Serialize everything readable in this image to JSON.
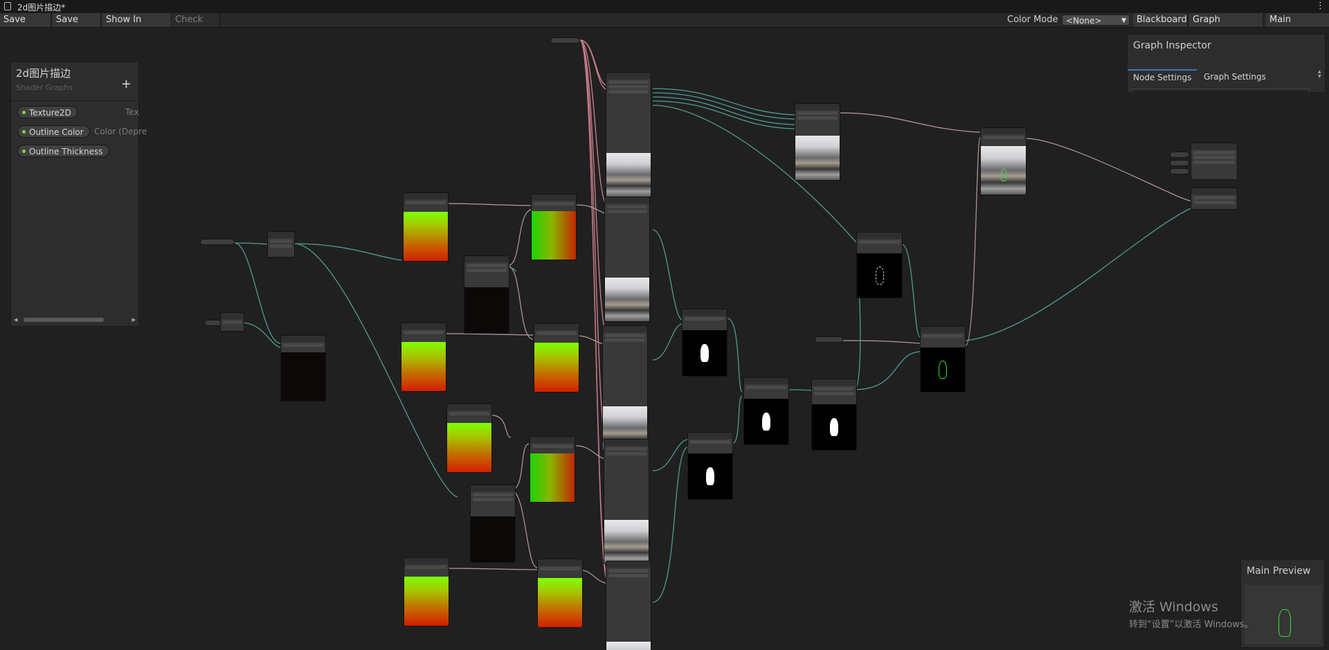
{
  "window": {
    "title": "2d图片描边*",
    "menu_icon": "kebab-icon"
  },
  "toolbar": {
    "save_asset": "Save Asset",
    "save_as": "Save As...",
    "show_in_project": "Show In Project",
    "check_out": "Check Out",
    "color_mode_label": "Color Mode",
    "color_mode_value": "<None>",
    "blackboard": "Blackboard",
    "graph_inspector": "Graph Inspector",
    "main_preview": "Main Preview"
  },
  "blackboard": {
    "title": "2d图片描边",
    "subtitle": "Shader Graphs",
    "add_icon": "+",
    "properties": [
      {
        "name": "Texture2D",
        "type": "Tex"
      },
      {
        "name": "Outline Color",
        "type": "Color (Depre"
      },
      {
        "name": "Outline Thickness",
        "type": ""
      }
    ]
  },
  "inspector": {
    "title": "Graph Inspector",
    "tabs": [
      "Node Settings",
      "Graph Settings"
    ],
    "active_tab": "Node Settings"
  },
  "preview": {
    "title": "Main Preview"
  },
  "watermark": {
    "line1": "激活 Windows",
    "line2": "转到“设置”以激活 Windows。"
  },
  "colors": {
    "background": "#202020",
    "wire_texture": "#c57c8a",
    "wire_vector": "#4f9d93",
    "wire_float": "#b59c9f",
    "preview_accent": "#38e038",
    "tab_underline": "#3a79bb",
    "property_dot": "#7fd14c"
  }
}
